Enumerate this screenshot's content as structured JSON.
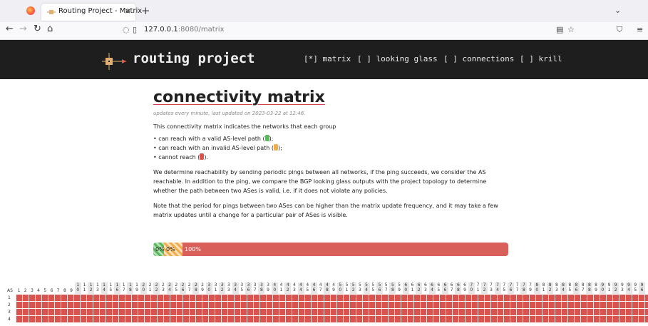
{
  "browser": {
    "tab_title": "Routing Project - Matrix",
    "tab_close": "×",
    "new_tab": "+",
    "url_host": "127.0.0.1",
    "url_rest": ":8080/matrix",
    "tab_list": "⌄"
  },
  "site": {
    "brand": "routing project",
    "menu": [
      {
        "label": "[*] matrix"
      },
      {
        "label": "[ ] looking glass"
      },
      {
        "label": "[ ] connections"
      },
      {
        "label": "[ ] krill"
      }
    ]
  },
  "content": {
    "title": "connectivity matrix",
    "updated": "updates every minute, last updated on 2023-03-22 at 12:46.",
    "intro": "This connectivity matrix indicates the networks that each group",
    "bullets": [
      {
        "pre": "can reach with a valid AS-level path (",
        "post": ");",
        "color": "green"
      },
      {
        "pre": "can reach with an invalid AS-level path (",
        "post": ");",
        "color": "orange"
      },
      {
        "pre": "cannot reach (",
        "post": ").",
        "color": "red"
      }
    ],
    "para1": "We determine reachability by sending periodic pings between all networks, if the ping succeeds, we consider the AS reachable. In addition to the ping, we compare the BGP looking glass outputs with the project topology to determine whether the path between two ASes is valid, i.e. if it does not violate any policies.",
    "para2": "Note that the period for pings between two ASes can be higher than the matrix update frequency, and it may take a few matrix updates until a change for a particular pair of ASes is visible."
  },
  "progress": {
    "valid": "0%",
    "invalid": "0%",
    "unreachable": "100%",
    "valid_fraction": 0,
    "invalid_fraction": 0,
    "unreachable_fraction": 1.0
  },
  "matrix": {
    "as_label": "AS",
    "columns": [
      "1",
      "2",
      "3",
      "4",
      "5",
      "6",
      "7",
      "8",
      "9",
      "10",
      "11",
      "12",
      "13",
      "14",
      "15",
      "16",
      "17",
      "18",
      "19",
      "20",
      "21",
      "22",
      "23",
      "24",
      "25",
      "26",
      "27",
      "28",
      "29",
      "30",
      "31",
      "32",
      "33",
      "34",
      "35",
      "36",
      "37",
      "38",
      "39",
      "40",
      "41",
      "42",
      "43",
      "44",
      "45",
      "46",
      "47",
      "48",
      "49",
      "50",
      "51",
      "52",
      "53",
      "54",
      "55",
      "56",
      "57",
      "58",
      "59",
      "60",
      "61",
      "62",
      "63",
      "64",
      "65",
      "66",
      "67",
      "68",
      "69",
      "70",
      "71",
      "72",
      "73",
      "74",
      "75",
      "76",
      "77",
      "78",
      "79",
      "80",
      "81",
      "82",
      "83",
      "84",
      "85",
      "86",
      "87",
      "88",
      "89",
      "90",
      "91",
      "92",
      "93",
      "94",
      "95",
      "96"
    ],
    "rows": [
      "1",
      "2",
      "3",
      "4"
    ],
    "cell_state": "unreachable"
  },
  "colors": {
    "valid": "#5cb85c",
    "invalid": "#f0ad4e",
    "unreachable": "#d9534f",
    "header_bg": "#1e1e1e"
  }
}
